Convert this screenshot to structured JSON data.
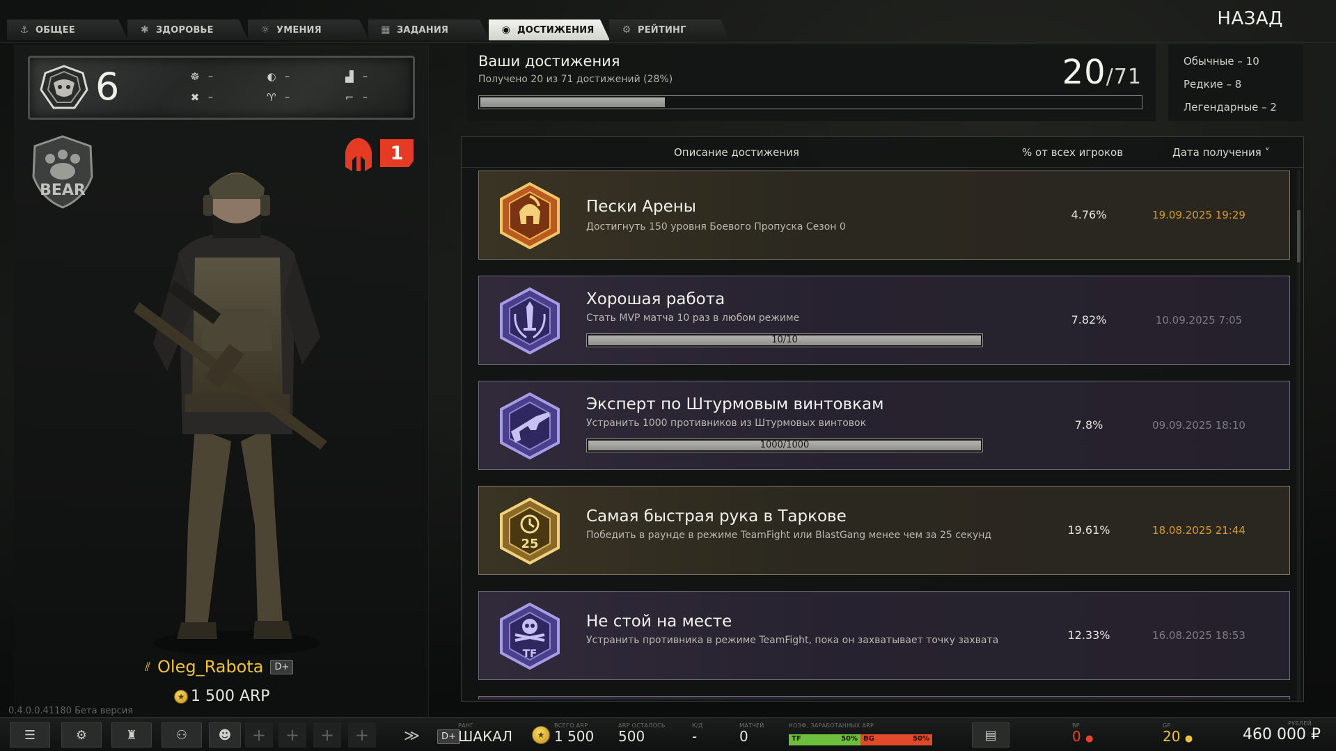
{
  "tabs": [
    {
      "label": "ОБЩЕЕ",
      "icon": "anchor-icon",
      "active": false
    },
    {
      "label": "ЗДОРОВЬЕ",
      "icon": "health-icon",
      "active": false
    },
    {
      "label": "УМЕНИЯ",
      "icon": "skills-icon",
      "active": false
    },
    {
      "label": "ЗАДАНИЯ",
      "icon": "calendar-icon",
      "active": false
    },
    {
      "label": "ДОСТИЖЕНИЯ",
      "icon": "achievement-icon",
      "active": true
    },
    {
      "label": "РЕЙТИНГ",
      "icon": "rating-icon",
      "active": false
    }
  ],
  "back_label": "НАЗАД",
  "profile": {
    "level": "6",
    "stats": [
      "–",
      "–",
      "–",
      "–",
      "–",
      "–"
    ],
    "rank_number": "1",
    "name": "Oleg_Rabota",
    "division": "D+",
    "arp": "1 500 ARP",
    "version": "0.4.0.0.41180 Бета версия"
  },
  "summary": {
    "title": "Ваши достижения",
    "subtitle": "Получено 20 из 71 достижений (28%)",
    "count": "20",
    "total": "/71",
    "progress": 0.28
  },
  "types": [
    "Обычные – 10",
    "Редкие – 8",
    "Легендарные – 2"
  ],
  "table": {
    "col_desc": "Описание достижения",
    "col_pct": "% от всех игроков",
    "col_date": "Дата получения ˅",
    "rows": [
      {
        "title": "Пески Арены",
        "desc": "Достигнуть 150 уровня Боевого Пропуска Сезон 0",
        "pct": "4.76%",
        "date": "19.09.2025 19:29",
        "rarity": "legendary",
        "icon": "spartan-helmet-icon"
      },
      {
        "title": "Хорошая работа",
        "desc": "Стать MVP матча 10 раз в любом режиме",
        "pct": "7.82%",
        "date": "10.09.2025 7:05",
        "rarity": "rare",
        "icon": "sword-laurel-icon",
        "bar": "10/10",
        "bar_fraction": 1
      },
      {
        "title": "Эксперт по Штурмовым винтовкам",
        "desc": "Устранить 1000 противников из Штурмовых винтовок",
        "pct": "7.8%",
        "date": "09.09.2025 18:10",
        "rarity": "rare",
        "icon": "assault-rifle-icon",
        "bar": "1000/1000",
        "bar_fraction": 1
      },
      {
        "title": "Самая быстрая рука в Таркове",
        "desc": "Победить в раунде в режиме TeamFight или BlastGang менее чем за 25 секунд",
        "pct": "19.61%",
        "date": "18.08.2025 21:44",
        "rarity": "legendary",
        "icon": "stopwatch-trophy-icon"
      },
      {
        "title": "Не стой на месте",
        "desc": "Устранить противника в режиме TeamFight, пока он захватывает точку захвата",
        "pct": "12.33%",
        "date": "16.08.2025 18:53",
        "rarity": "rare",
        "icon": "skull-tf-icon"
      }
    ]
  },
  "bottom": {
    "rank_label": "РАНГ",
    "rank_value": "ШАКАЛ",
    "division": "D+",
    "total_arp_label": "ВСЕГО ARP",
    "total_arp": "1 500",
    "arp_left_label": "ARP ОСТАЛОСЬ",
    "arp_left": "500",
    "kd_label": "К/Д",
    "kd": "-",
    "matches_label": "МАТЧЕЙ",
    "matches": "0",
    "coef_label": "КОЭФ. ЗАРАБОТАННЫХ ARP",
    "tf_label": "TF",
    "tf_pct": "50%",
    "bg_label": "BG",
    "bg_pct": "50%",
    "bp_label": "BP",
    "bp_value": "0",
    "gp_label": "GP",
    "gp_value": "20",
    "rub_label": "РУБЛЕЙ",
    "rub_value": "460 000 ₽"
  }
}
